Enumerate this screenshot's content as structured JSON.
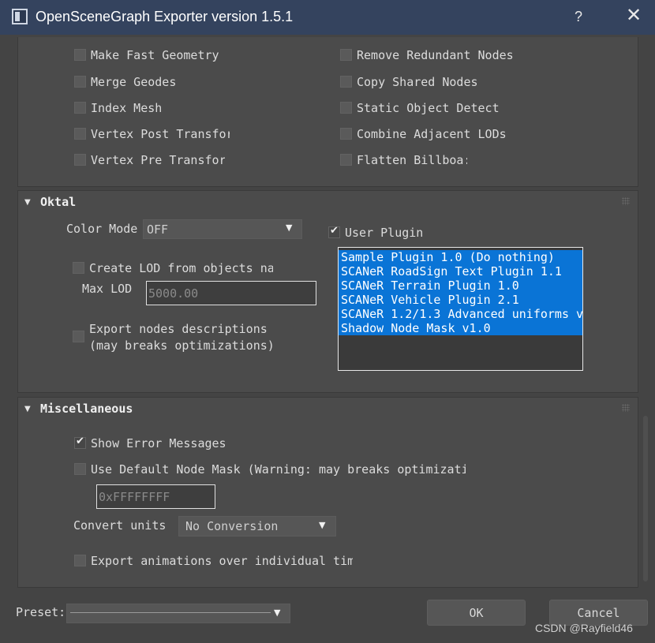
{
  "window": {
    "title": "OpenSceneGraph Exporter version 1.5.1",
    "help": "?",
    "close": "✕"
  },
  "optimizations": {
    "left": [
      {
        "label": "Make Fast Geometry",
        "checked": false
      },
      {
        "label": "Merge Geodes",
        "checked": false
      },
      {
        "label": "Index Mesh",
        "checked": false
      },
      {
        "label": "Vertex Post Transfor",
        "checked": false
      },
      {
        "label": "Vertex Pre Transfor",
        "checked": false
      }
    ],
    "right": [
      {
        "label": "Remove Redundant Nodes",
        "checked": false
      },
      {
        "label": "Copy Shared Nodes",
        "checked": false
      },
      {
        "label": "Static Object Detect",
        "checked": false
      },
      {
        "label": "Combine Adjacent LODs",
        "checked": false
      },
      {
        "label": "Flatten Billboa:",
        "checked": false
      }
    ]
  },
  "oktal": {
    "title": "Oktal",
    "color_mode_label": "Color Mode",
    "color_mode_value": "OFF",
    "user_plugin_label": "User Plugin",
    "user_plugin_checked": true,
    "create_lod_label": "Create LOD from objects na",
    "max_lod_label": "Max LOD",
    "max_lod_value": "5000.00",
    "export_desc_line1": "Export nodes descriptions",
    "export_desc_line2": "(may breaks optimizations)",
    "plugins": [
      "Sample Plugin 1.0 (Do nothing)",
      "SCANeR RoadSign Text Plugin 1.1",
      "SCANeR Terrain Plugin 1.0",
      "SCANeR Vehicle Plugin 2.1",
      "SCANeR 1.2/1.3 Advanced uniforms v",
      "Shadow Node Mask v1.0"
    ]
  },
  "misc": {
    "title": "Miscellaneous",
    "show_errors_label": "Show Error Messages",
    "show_errors_checked": true,
    "default_mask_label": "Use Default Node Mask (Warning: may breaks optimizati",
    "node_mask_value": "0xFFFFFFFF",
    "convert_units_label": "Convert units",
    "convert_units_value": "No Conversion",
    "export_anim_label": "Export animations over individual tim"
  },
  "footer": {
    "preset_label": "Preset:",
    "ok_label": "OK",
    "cancel_label": "Cancel"
  },
  "watermark": "CSDN @Rayfield46"
}
